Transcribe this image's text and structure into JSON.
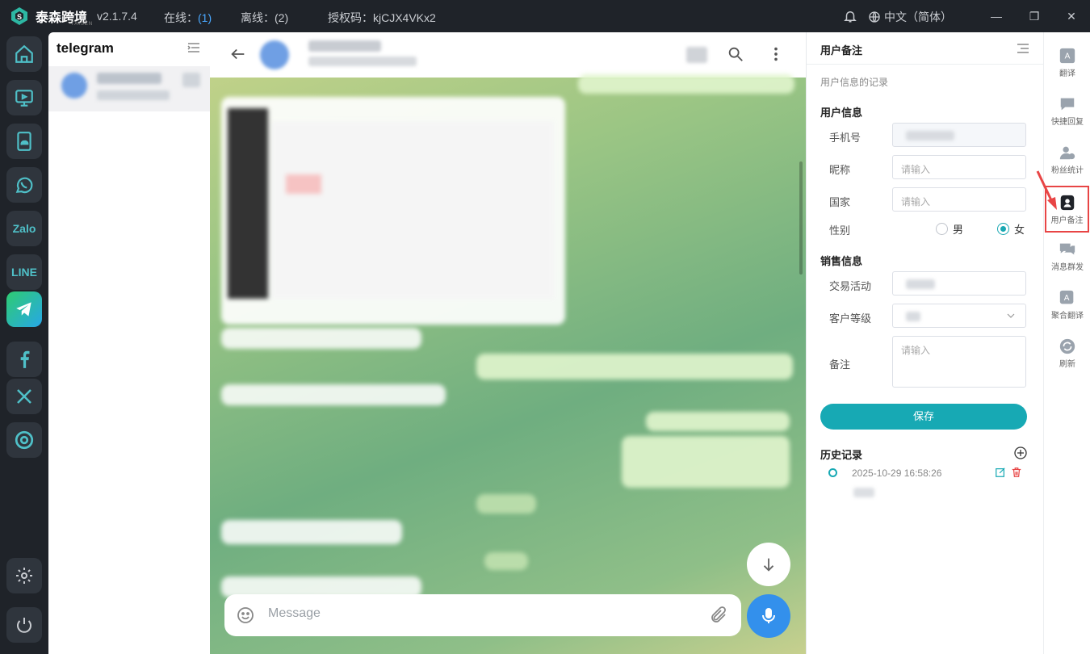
{
  "titlebar": {
    "brand": "泰森跨境",
    "brand_sub": "TAISEN",
    "version": "v2.1.7.4",
    "online_label": "在线：",
    "online_count": "(1)",
    "offline_label": "离线：",
    "offline_count": "(2)",
    "license_label": "授权码：",
    "license_code": "kjCJX4VKx2",
    "language": "中文（简体）"
  },
  "dock": {
    "items": [
      {
        "name": "home",
        "icon": "home-icon"
      },
      {
        "name": "desktop",
        "icon": "monitor-icon"
      },
      {
        "name": "cloud",
        "icon": "cloud-phone-icon"
      },
      {
        "name": "whatsapp",
        "icon": "whatsapp-icon"
      },
      {
        "name": "zalo",
        "label": "Zalo"
      },
      {
        "name": "line",
        "label": "LINE"
      },
      {
        "name": "telegram",
        "icon": "telegram-icon"
      },
      {
        "name": "facebook",
        "icon": "facebook-icon"
      },
      {
        "name": "x",
        "icon": "x-icon"
      },
      {
        "name": "chrome",
        "icon": "chrome-icon"
      },
      {
        "name": "settings",
        "icon": "gear-icon"
      },
      {
        "name": "power",
        "icon": "power-icon"
      }
    ]
  },
  "contacts": {
    "title": "telegram"
  },
  "chat": {
    "message_placeholder": "Message"
  },
  "panel": {
    "title": "用户备注",
    "subtitle": "用户信息的记录",
    "user_info_title": "用户信息",
    "fields": {
      "phone_label": "手机号",
      "nickname_label": "昵称",
      "nickname_placeholder": "请输入",
      "country_label": "国家",
      "country_placeholder": "请输入",
      "gender_label": "性别",
      "gender_male": "男",
      "gender_female": "女",
      "gender_selected": "女"
    },
    "sales_info_title": "销售信息",
    "sales": {
      "activity_label": "交易活动",
      "level_label": "客户等级",
      "note_label": "备注",
      "note_placeholder": "请输入"
    },
    "save_label": "保存",
    "history_title": "历史记录",
    "history": [
      {
        "time": "2025-10-29 16:58:26"
      }
    ]
  },
  "toolbar": {
    "items": [
      {
        "label": "翻译",
        "icon": "translate-icon"
      },
      {
        "label": "快捷回复",
        "icon": "quick-reply-icon"
      },
      {
        "label": "粉丝统计",
        "icon": "fans-stats-icon"
      },
      {
        "label": "用户备注",
        "icon": "user-note-icon",
        "active": true
      },
      {
        "label": "消息群发",
        "icon": "broadcast-icon"
      },
      {
        "label": "聚合翻译",
        "icon": "aggregate-translate-icon"
      },
      {
        "label": "刷新",
        "icon": "refresh-icon"
      }
    ]
  },
  "colors": {
    "accent": "#17a9b4",
    "telegram_blue": "#3390ec",
    "highlight_red": "#e84545"
  }
}
